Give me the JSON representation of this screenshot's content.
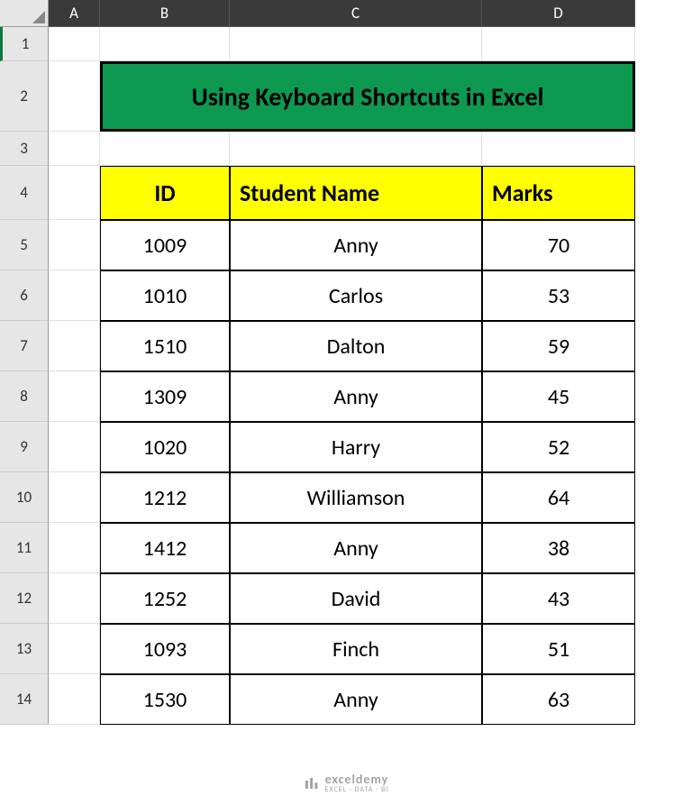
{
  "columns": [
    "A",
    "B",
    "C",
    "D"
  ],
  "rows": [
    "1",
    "2",
    "3",
    "4",
    "5",
    "6",
    "7",
    "8",
    "9",
    "10",
    "11",
    "12",
    "13",
    "14"
  ],
  "title": "Using Keyboard Shortcuts in Excel",
  "headers": {
    "id": "ID",
    "name": "Student Name",
    "marks": "Marks"
  },
  "table": [
    {
      "id": "1009",
      "name": "Anny",
      "marks": "70"
    },
    {
      "id": "1010",
      "name": "Carlos",
      "marks": "53"
    },
    {
      "id": "1510",
      "name": "Dalton",
      "marks": "59"
    },
    {
      "id": "1309",
      "name": "Anny",
      "marks": "45"
    },
    {
      "id": "1020",
      "name": "Harry",
      "marks": "52"
    },
    {
      "id": "1212",
      "name": "Williamson",
      "marks": "64"
    },
    {
      "id": "1412",
      "name": "Anny",
      "marks": "38"
    },
    {
      "id": "1252",
      "name": "David",
      "marks": "43"
    },
    {
      "id": "1093",
      "name": "Finch",
      "marks": "51"
    },
    {
      "id": "1530",
      "name": "Anny",
      "marks": "63"
    }
  ],
  "watermark": {
    "brand": "exceldemy",
    "tagline": "EXCEL · DATA · BI"
  }
}
